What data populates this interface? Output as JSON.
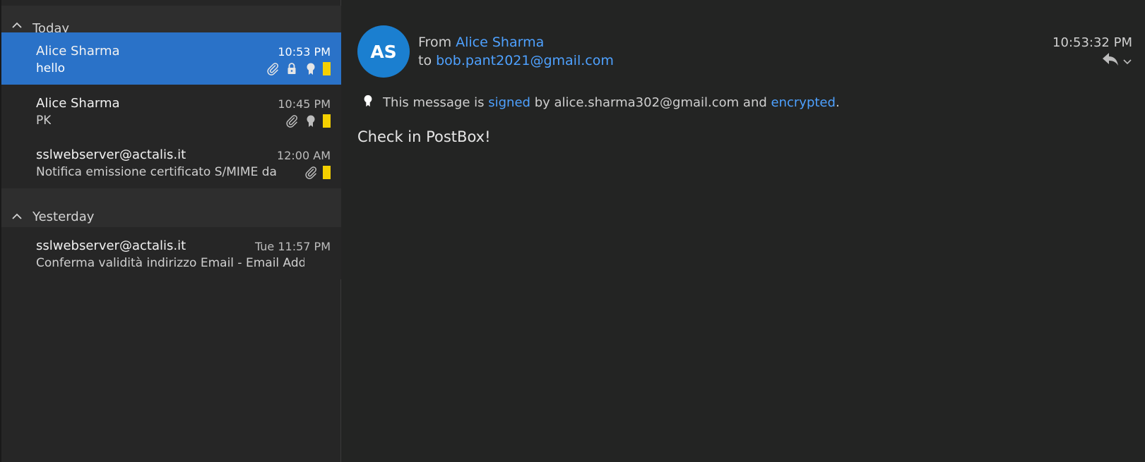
{
  "message_list": {
    "groups": [
      {
        "label": "Today",
        "items": [
          {
            "sender": "Alice Sharma",
            "subject": "hello",
            "time": "10:53 PM"
          },
          {
            "sender": "Alice Sharma",
            "subject": "PK",
            "time": "10:45 PM"
          },
          {
            "sender": "sslwebserver@actalis.it",
            "subject": "Notifica emissione certificato S/MIME da ...",
            "time": "12:00 AM"
          }
        ]
      },
      {
        "label": "Yesterday",
        "items": [
          {
            "sender": "sslwebserver@actalis.it",
            "subject": "Conferma validità indirizzo Email - Email Addre...",
            "time": "Tue 11:57 PM"
          }
        ]
      }
    ]
  },
  "reading_pane": {
    "avatar_initials": "AS",
    "from_label": "From",
    "from_name": "Alice Sharma",
    "to_label": "to",
    "to_address": "bob.pant2021@gmail.com",
    "time": "10:53:32 PM",
    "security": {
      "prefix": "This message is",
      "signed_link": "signed",
      "middle": "by alice.sharma302@gmail.com and",
      "encrypted_link": "encrypted",
      "suffix": "."
    },
    "body": "Check in PostBox!"
  },
  "colors": {
    "selected": "#2a72c8",
    "link": "#4ea1ff",
    "flag": "#f5d000",
    "avatar": "#1b7fd0"
  }
}
